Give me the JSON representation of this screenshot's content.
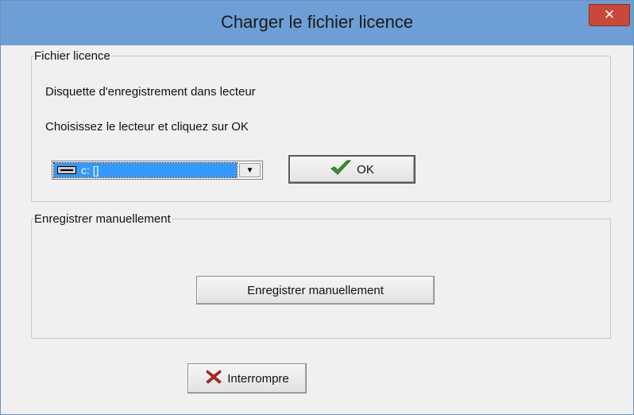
{
  "window": {
    "title": "Charger le fichier licence",
    "close_label": "✕"
  },
  "group_file": {
    "legend": "Fichier licence",
    "line1": "Disquette d'enregistrement dans lecteur",
    "line2": "Choisissez le lecteur et cliquez sur OK",
    "drive_select": {
      "value": "c: []",
      "icon": "drive-icon"
    },
    "ok_button": {
      "label": "OK",
      "icon": "checkmark-icon",
      "icon_color": "#2f9b24"
    }
  },
  "group_manual": {
    "legend": "Enregistrer manuellement",
    "button_label": "Enregistrer manuellement"
  },
  "footer": {
    "abort_button": {
      "label": "Interrompre",
      "icon": "cross-icon",
      "icon_color": "#c22d21"
    }
  },
  "colors": {
    "titlebar": "#6d9fd6",
    "close_button": "#c8483a",
    "selection": "#3399ff",
    "dialog_background": "#f0f0f0"
  }
}
